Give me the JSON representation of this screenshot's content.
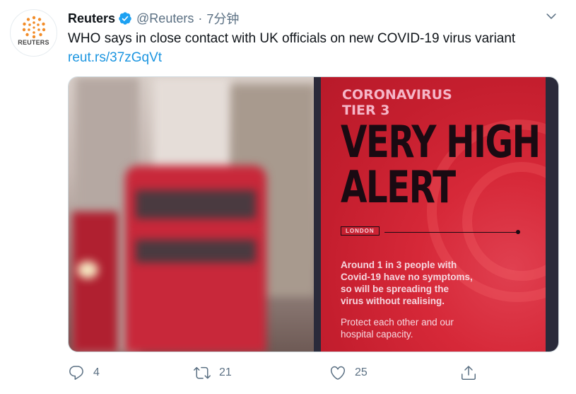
{
  "tweet": {
    "avatar_brand": "REUTERS",
    "author_name": "Reuters",
    "author_handle": "@Reuters",
    "separator": "·",
    "time": "7分钟",
    "text": "WHO says in close contact with UK officials on new COVID-19 virus variant",
    "link": "reut.rs/37zGqVt",
    "icons": {
      "verified": "verified-badge-icon",
      "menu": "chevron-down-icon",
      "reply": "reply-icon",
      "retweet": "retweet-icon",
      "like": "heart-icon",
      "share": "share-icon"
    },
    "colors": {
      "link": "#1b95e0",
      "verified": "#1da1f2",
      "muted": "#5b7083",
      "poster_red": "#c41e2e"
    }
  },
  "media": {
    "poster": {
      "subtitle_line1": "CORONAVIRUS",
      "subtitle_line2": "TIER 3",
      "headline_line1": "VERY HIGH",
      "headline_line2": "ALERT",
      "tag": "LONDON",
      "body_line1": "Around 1 in 3 people with",
      "body_line2": "Covid-19 have no symptoms,",
      "body_line3": "so will be spreading the",
      "body_line4": "virus without realising.",
      "body2_line1": "Protect each other and our",
      "body2_line2": "hospital capacity."
    }
  },
  "actions": {
    "reply_count": "4",
    "retweet_count": "21",
    "like_count": "25"
  }
}
